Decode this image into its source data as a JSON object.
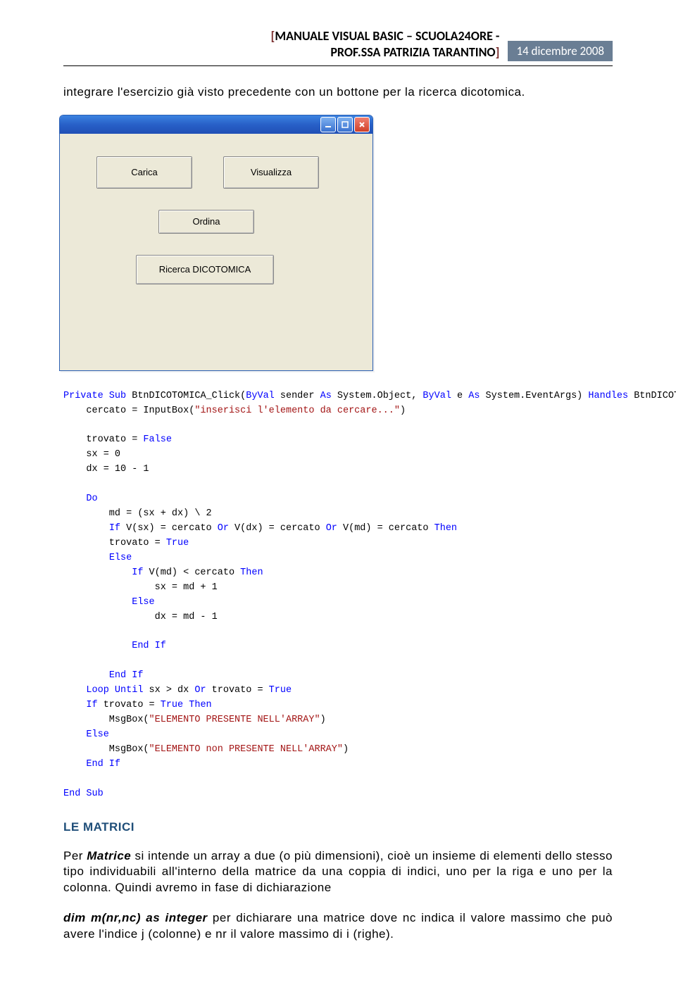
{
  "header": {
    "bracket_open": "[",
    "title_line1": "MANUALE VISUAL BASIC – SCUOLA24ORE -",
    "title_line2": "PROF.SSA PATRIZIA TARANTINO",
    "bracket_close": "]",
    "date": "14 dicembre 2008"
  },
  "p1": "integrare l'esercizio già visto precedente con un bottone per la ricerca dicotomica.",
  "win": {
    "btn_carica": "Carica",
    "btn_visualizza": "Visualizza",
    "btn_ordina": "Ordina",
    "btn_ricerca": "Ricerca DICOTOMICA"
  },
  "code": {
    "l0a": "Private Sub",
    "l0b": " BtnDICOTOMICA_Click(",
    "l0c": "ByVal",
    "l0d": " sender ",
    "l0e": "As",
    "l0f": " System.Object, ",
    "l0g": "ByVal",
    "l0h": " e ",
    "l0i": "As",
    "l0j": " System.EventArgs) ",
    "l0k": "Handles",
    "l0l": " BtnDICOTOM",
    "l1a": "    cercato = InputBox(",
    "l1b": "\"inserisci l'elemento da cercare...\"",
    "l1c": ")",
    "l2": "    trovato = ",
    "l2b": "False",
    "l3": "    sx = 0",
    "l4": "    dx = 10 - 1",
    "l5": "    ",
    "l5b": "Do",
    "l6": "        md = (sx + dx) \\ 2",
    "l7a": "        ",
    "l7b": "If",
    "l7c": " V(sx) = cercato ",
    "l7d": "Or",
    "l7e": " V(dx) = cercato ",
    "l7f": "Or",
    "l7g": " V(md) = cercato ",
    "l7h": "Then",
    "l8": "        trovato = ",
    "l8b": "True",
    "l9": "        ",
    "l9b": "Else",
    "l10a": "            ",
    "l10b": "If",
    "l10c": " V(md) < cercato ",
    "l10d": "Then",
    "l11": "                sx = md + 1",
    "l12": "            ",
    "l12b": "Else",
    "l13": "                dx = md - 1",
    "l14": "            ",
    "l14b": "End If",
    "l15": "        ",
    "l15b": "End If",
    "l16a": "    ",
    "l16b": "Loop Until",
    "l16c": " sx > dx ",
    "l16d": "Or",
    "l16e": " trovato = ",
    "l16f": "True",
    "l17a": "    ",
    "l17b": "If",
    "l17c": " trovato = ",
    "l17d": "True Then",
    "l18a": "        MsgBox(",
    "l18b": "\"ELEMENTO PRESENTE NELL'ARRAY\"",
    "l18c": ")",
    "l19": "    ",
    "l19b": "Else",
    "l20a": "        MsgBox(",
    "l20b": "\"ELEMENTO non PRESENTE NELL'ARRAY\"",
    "l20c": ")",
    "l21": "    ",
    "l21b": "End If",
    "l22": "End Sub"
  },
  "heading": "LE MATRICI",
  "p2a": "Per ",
  "p2b": "Matrice",
  "p2c": " si intende un array a due (o più dimensioni), cioè un insieme di elementi dello stesso tipo individuabili all'interno della matrice da una coppia di indici, uno per la riga e uno per la colonna. Quindi avremo in fase di dichiarazione",
  "p3a": "dim m(nr,nc) as integer ",
  "p3b": "per dichiarare una matrice dove nc indica il valore massimo che può avere l'indice j (colonne) e nr il valore massimo di i (righe)."
}
